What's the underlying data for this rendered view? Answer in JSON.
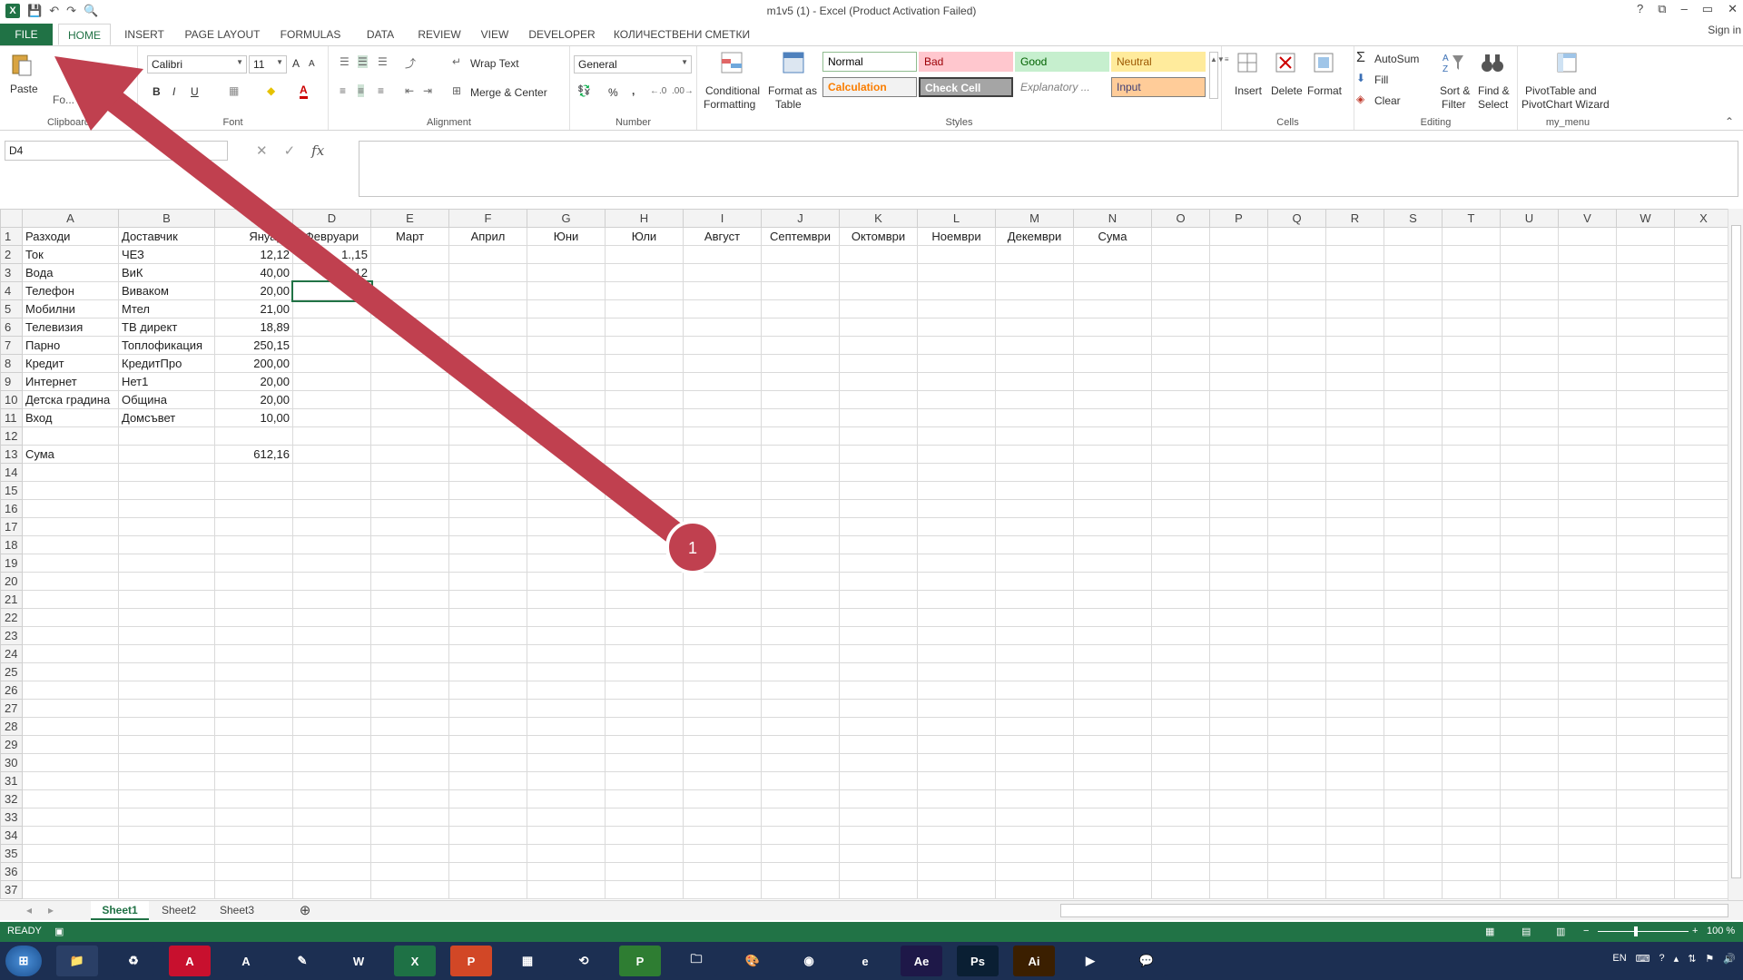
{
  "window": {
    "title": "m1v5 (1) - Excel (Product Activation Failed)",
    "help": "?",
    "restore_ribbon": "⧉",
    "minimize": "–",
    "maximize": "▭",
    "close": "✕"
  },
  "qat": {
    "logo": "X",
    "save_icon": "💾",
    "undo_icon": "↶",
    "redo_icon": "↷",
    "preview_icon": "🔍"
  },
  "tabs": [
    "FILE",
    "HOME",
    "INSERT",
    "PAGE LAYOUT",
    "FORMULAS",
    "DATA",
    "REVIEW",
    "VIEW",
    "DEVELOPER",
    "КОЛИЧЕСТВЕНИ СМЕТКИ"
  ],
  "signin": "Sign in",
  "ribbon": {
    "clipboard": {
      "label": "Clipboard",
      "paste": "Paste",
      "format_painter": "Fo..."
    },
    "font": {
      "label": "Font",
      "name": "Calibri",
      "size": "11",
      "bold": "B",
      "italic": "I",
      "underline": "U",
      "grow": "A",
      "shrink": "A"
    },
    "alignment": {
      "label": "Alignment",
      "wrap": "Wrap Text",
      "merge": "Merge & Center"
    },
    "number": {
      "label": "Number",
      "format": "General",
      "percent": "%",
      "comma": ","
    },
    "styles": {
      "label": "Styles",
      "conditional": [
        "Conditional",
        "Formatting"
      ],
      "format_table": [
        "Format as",
        "Table"
      ],
      "cells": [
        {
          "name": "Normal",
          "bg": "#ffffff",
          "fg": "#000000",
          "border": "#8fbc8f"
        },
        {
          "name": "Bad",
          "bg": "#ffc7ce",
          "fg": "#9c0006",
          "border": "#ffc7ce"
        },
        {
          "name": "Good",
          "bg": "#c6efce",
          "fg": "#006100",
          "border": "#c6efce"
        },
        {
          "name": "Neutral",
          "bg": "#ffeb9c",
          "fg": "#9c5700",
          "border": "#ffeb9c"
        },
        {
          "name": "Calculation",
          "bg": "#f2f2f2",
          "fg": "#fa7d00",
          "border": "#7f7f7f"
        },
        {
          "name": "Check Cell",
          "bg": "#a5a5a5",
          "fg": "#ffffff",
          "border": "#3f3f3f"
        },
        {
          "name": "Explanatory ...",
          "bg": "#ffffff",
          "fg": "#7f7f7f",
          "border": "#ffffff"
        },
        {
          "name": "Input",
          "bg": "#ffcc99",
          "fg": "#3f3f76",
          "border": "#7f7f7f"
        }
      ]
    },
    "cells": {
      "label": "Cells",
      "insert": "Insert",
      "delete": "Delete",
      "format": "Format"
    },
    "editing": {
      "label": "Editing",
      "autosum": "AutoSum",
      "fill": "Fill",
      "clear": "Clear",
      "sort": [
        "Sort &",
        "Filter"
      ],
      "find": [
        "Find &",
        "Select"
      ]
    },
    "my_menu": {
      "label": "my_menu",
      "pivot": [
        "PivotTable and",
        "PivotChart Wizard"
      ]
    }
  },
  "formula": {
    "namebox": "D4",
    "cancel": "✕",
    "enter": "✓",
    "fx": "fx",
    "content": ""
  },
  "columns": [
    "A",
    "B",
    "C",
    "D",
    "E",
    "F",
    "G",
    "H",
    "I",
    "J",
    "K",
    "L",
    "M",
    "N",
    "O",
    "P",
    "Q",
    "R",
    "S",
    "T",
    "U",
    "V",
    "W",
    "X"
  ],
  "rows": [
    [
      "Разходи",
      "Доставчик",
      "Януари",
      "Февруари",
      "Март",
      "Април",
      "Юни",
      "Юли",
      "Август",
      "Септември",
      "Октомври",
      "Ноември",
      "Декември",
      "Сума"
    ],
    [
      "Ток",
      "ЧЕЗ",
      "12,12",
      "1.,15"
    ],
    [
      "Вода",
      "ВиК",
      "40,00",
      "12"
    ],
    [
      "Телефон",
      "Виваком",
      "20,00"
    ],
    [
      "Мобилни",
      "Мтел",
      "21,00"
    ],
    [
      "Телевизия",
      "ТВ директ",
      "18,89"
    ],
    [
      "Парно",
      "Топлофикация",
      "250,15"
    ],
    [
      "Кредит",
      "КредитПро",
      "200,00"
    ],
    [
      "Интернет",
      "Нет1",
      "20,00"
    ],
    [
      "Детска градина",
      "Община",
      "20,00"
    ],
    [
      "Вход",
      "Домсъвет",
      "10,00"
    ],
    [],
    [
      "Сума",
      "",
      "612,16"
    ]
  ],
  "row_count": 37,
  "sheets": [
    "Sheet1",
    "Sheet2",
    "Sheet3"
  ],
  "add_sheet": "⊕",
  "status": {
    "mode": "READY",
    "zoom": "100 %"
  },
  "taskbar": {
    "apps": [
      {
        "name": "explorer",
        "glyph": "📁",
        "bg": "#2a3f66"
      },
      {
        "name": "recycle",
        "glyph": "♻",
        "bg": "#1c2f52"
      },
      {
        "name": "acrobat",
        "glyph": "A",
        "bg": "#c8102e"
      },
      {
        "name": "autocad",
        "glyph": "A",
        "bg": "#1c2f52"
      },
      {
        "name": "notes",
        "glyph": "✎",
        "bg": "#1c2f52"
      },
      {
        "name": "word",
        "glyph": "W",
        "bg": "#1c2f52"
      },
      {
        "name": "excel",
        "glyph": "X",
        "bg": "#1e7145"
      },
      {
        "name": "powerpoint",
        "glyph": "P",
        "bg": "#d24726"
      },
      {
        "name": "calculator",
        "glyph": "▦",
        "bg": "#1c2f52"
      },
      {
        "name": "network",
        "glyph": "⟲",
        "bg": "#1c2f52"
      },
      {
        "name": "project",
        "glyph": "P",
        "bg": "#2e7d32"
      },
      {
        "name": "folder",
        "glyph": "🗀",
        "bg": "#1c2f52"
      },
      {
        "name": "paint",
        "glyph": "🎨",
        "bg": "#1c2f52"
      },
      {
        "name": "chrome",
        "glyph": "◉",
        "bg": "#1c2f52"
      },
      {
        "name": "ie",
        "glyph": "e",
        "bg": "#1c2f52"
      },
      {
        "name": "after-effects",
        "glyph": "Ae",
        "bg": "#1e1848"
      },
      {
        "name": "photoshop",
        "glyph": "Ps",
        "bg": "#0a1f33"
      },
      {
        "name": "illustrator",
        "glyph": "Ai",
        "bg": "#3b1f00"
      },
      {
        "name": "media",
        "glyph": "▶",
        "bg": "#1c2f52"
      },
      {
        "name": "chat",
        "glyph": "💬",
        "bg": "#1c2f52"
      }
    ],
    "lang": "EN"
  },
  "annotation": {
    "number": "1",
    "color": "#c0404f"
  }
}
